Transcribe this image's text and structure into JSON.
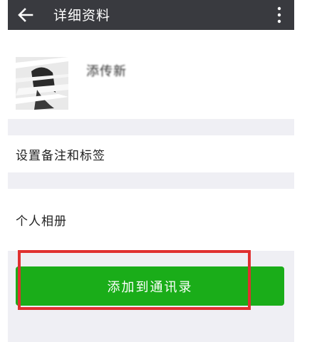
{
  "appbar": {
    "title": "详细资料",
    "back_icon": "arrow-left-icon",
    "more_icon": "more-vert-icon"
  },
  "profile": {
    "nickname": "添传新"
  },
  "rows": {
    "remark_label": "设置备注和标签",
    "album_label": "个人相册"
  },
  "actions": {
    "add_contact_label": "添加到通讯录"
  },
  "colors": {
    "appbar": "#393a3f",
    "background": "#efeff4",
    "primary_button": "#1aad19",
    "highlight": "#e03030"
  }
}
